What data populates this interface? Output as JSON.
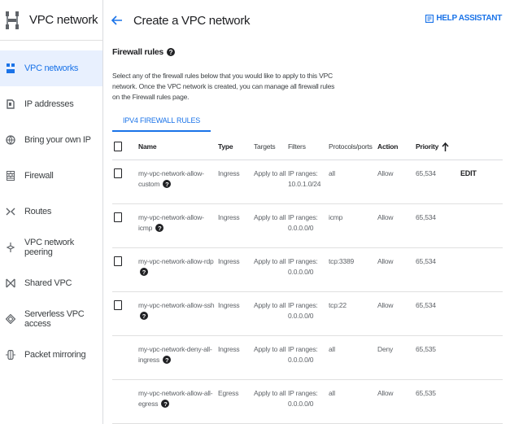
{
  "sidebar": {
    "title": "VPC network",
    "items": [
      {
        "label": "VPC networks",
        "icon": "vpc-networks-icon",
        "active": true
      },
      {
        "label": "IP addresses",
        "icon": "ip-addresses-icon"
      },
      {
        "label": "Bring your own IP",
        "icon": "byoip-icon"
      },
      {
        "label": "Firewall",
        "icon": "firewall-icon"
      },
      {
        "label": "Routes",
        "icon": "routes-icon"
      },
      {
        "label": "VPC network peering",
        "icon": "peering-icon"
      },
      {
        "label": "Shared VPC",
        "icon": "shared-vpc-icon"
      },
      {
        "label": "Serverless VPC access",
        "icon": "serverless-icon"
      },
      {
        "label": "Packet mirroring",
        "icon": "packet-mirroring-icon"
      }
    ]
  },
  "header": {
    "title": "Create a VPC network",
    "help_label": "HELP ASSISTANT"
  },
  "main": {
    "section_title": "Firewall rules",
    "description": "Select any of the firewall rules below that you would like to apply to this VPC network. Once the VPC network is created, you can manage all firewall rules on the Firewall rules page.",
    "tab": "IPV4 FIREWALL RULES",
    "columns": {
      "name": "Name",
      "type": "Type",
      "targets": "Targets",
      "filters": "Filters",
      "protocols": "Protocols/ports",
      "action": "Action",
      "priority": "Priority"
    },
    "edit_label": "EDIT",
    "rows": [
      {
        "name": "my-vpc-network-allow-custom",
        "type": "Ingress",
        "targets": "Apply to all",
        "filters": "IP ranges: 10.0.1.0/24",
        "protocols": "all",
        "action": "Allow",
        "priority": "65,534"
      },
      {
        "name": "my-vpc-network-allow-icmp",
        "type": "Ingress",
        "targets": "Apply to all",
        "filters": "IP ranges: 0.0.0.0/0",
        "protocols": "icmp",
        "action": "Allow",
        "priority": "65,534"
      },
      {
        "name": "my-vpc-network-allow-rdp",
        "type": "Ingress",
        "targets": "Apply to all",
        "filters": "IP ranges: 0.0.0.0/0",
        "protocols": "tcp:3389",
        "action": "Allow",
        "priority": "65,534"
      },
      {
        "name": "my-vpc-network-allow-ssh",
        "type": "Ingress",
        "targets": "Apply to all",
        "filters": "IP ranges: 0.0.0.0/0",
        "protocols": "tcp:22",
        "action": "Allow",
        "priority": "65,534"
      },
      {
        "name": "my-vpc-network-deny-all-ingress",
        "type": "Ingress",
        "targets": "Apply to all",
        "filters": "IP ranges: 0.0.0.0/0",
        "protocols": "all",
        "action": "Deny",
        "priority": "65,535"
      },
      {
        "name": "my-vpc-network-allow-all-egress",
        "type": "Egress",
        "targets": "Apply to all",
        "filters": "IP ranges: 0.0.0.0/0",
        "protocols": "all",
        "action": "Allow",
        "priority": "65,535"
      }
    ]
  },
  "colors": {
    "accent": "#1a73e8",
    "active_bg": "#e8f0fe"
  }
}
